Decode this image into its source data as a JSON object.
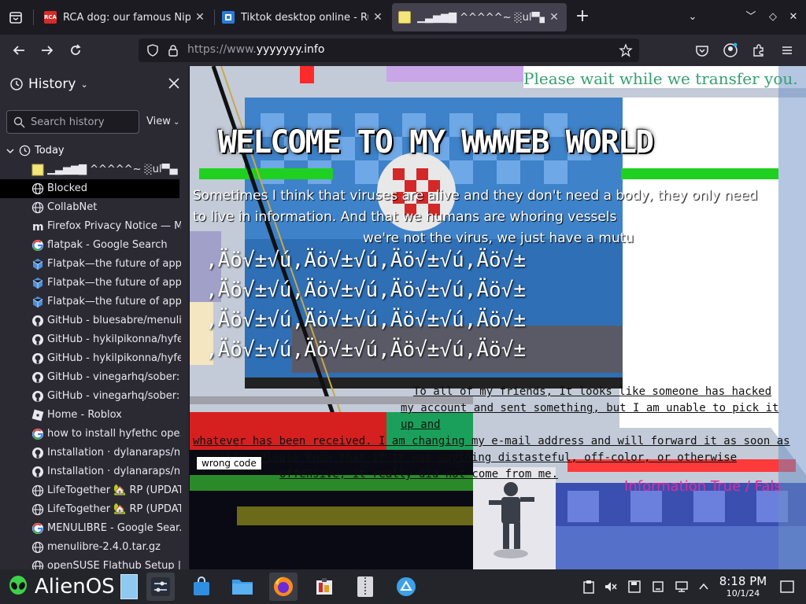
{
  "tabs": [
    {
      "title": "RCA dog: our famous Nipp",
      "favicon_text": "RCA",
      "favicon_color": "#d62b2b",
      "active": false
    },
    {
      "title": "Tiktok desktop online - Rur",
      "favicon_text": "",
      "favicon_color": "#2a7bd6",
      "active": false
    },
    {
      "title": "▁▃▅▆▇ ^^^^^~ ░ul▀▄",
      "favicon_text": "",
      "favicon_color": "#f3e67a",
      "active": true
    }
  ],
  "toolbar": {
    "url_prefix": "https://www.",
    "url_host": "yyyyyyy.info"
  },
  "sidebar": {
    "title": "History",
    "search_placeholder": "Search history",
    "view_label": "View",
    "group_label": "Today",
    "items": [
      {
        "label": "▁▃▅▆▇ ^^^^^~ ░ul▀▄",
        "icon": "yellow-square-icon"
      },
      {
        "label": "Blocked",
        "icon": "globe-icon"
      },
      {
        "label": "CollabNet",
        "icon": "globe-icon"
      },
      {
        "label": "Firefox Privacy Notice — M",
        "icon": "mozilla-icon"
      },
      {
        "label": "flatpak - Google Search",
        "icon": "google-icon"
      },
      {
        "label": "Flatpak—the future of app.",
        "icon": "flatpak-icon"
      },
      {
        "label": "Flatpak—the future of app.",
        "icon": "flatpak-icon"
      },
      {
        "label": "Flatpak—the future of app.",
        "icon": "flatpak-icon"
      },
      {
        "label": "GitHub - bluesabre/menuli.",
        "icon": "github-icon"
      },
      {
        "label": "GitHub - hykilpikonna/hyfe",
        "icon": "github-icon"
      },
      {
        "label": "GitHub - hykilpikonna/hyfe",
        "icon": "github-icon"
      },
      {
        "label": "GitHub - vinegarhq/sober:",
        "icon": "github-icon"
      },
      {
        "label": "GitHub - vinegarhq/sober:",
        "icon": "github-icon"
      },
      {
        "label": "Home - Roblox",
        "icon": "roblox-icon"
      },
      {
        "label": "how to install hyfethc ope..",
        "icon": "google-icon"
      },
      {
        "label": "Installation · dylanaraps/n..",
        "icon": "github-icon"
      },
      {
        "label": "Installation · dylanaraps/n..",
        "icon": "github-icon"
      },
      {
        "label": "LifeTogether 🏡 RP (UPDAT.",
        "icon": "globe-icon"
      },
      {
        "label": "LifeTogether 🏡 RP (UPDAT.",
        "icon": "globe-icon"
      },
      {
        "label": "MENULIBRE - Google Sear..",
        "icon": "google-icon"
      },
      {
        "label": "menulibre-2.4.0.tar.gz",
        "icon": "globe-icon"
      },
      {
        "label": "openSUSE Flathub Setup |",
        "icon": "globe-icon"
      }
    ]
  },
  "page": {
    "heading": "WELCOME TO MY WWWEB WORLD",
    "please_wait": "Please wait while we transfer you.",
    "paragraph_1": "Sometimes I think that viruses are alive and they don't need a body, they only need",
    "paragraph_2": "to live in information. And that we humans are whoring vessels",
    "paragraph_3": "we're not the virus, we just have a mutu",
    "glyph_row": ",Äö√±√ú,Äö√±√ú,Äö√±√ú,Äö√±",
    "note_1": "To all of my friends, It looks like someone has hacked",
    "note_2": "my account and sent something, but I am unable to pick it up and",
    "note_3": "whatever has been received. I am changing my e-mail address and will forward it as soon as",
    "note_4": "possible. Please know that if it was anything distasteful, off-color, or otherwise",
    "note_5": "offensive, it really did not come from me.",
    "wrong_code": "wrong code",
    "info_text": "Information True / Fals"
  },
  "taskbar": {
    "os_label": "AlienOS",
    "time": "8:18 PM",
    "date": "10/1/24"
  },
  "colors": {
    "chrome_dark": "#1c1b22",
    "chrome_mid": "#2b2a33",
    "active_tab": "#42414d",
    "taskbar": "#23252b",
    "accent_green": "#37c837",
    "accent_pink": "#e02aa0"
  }
}
